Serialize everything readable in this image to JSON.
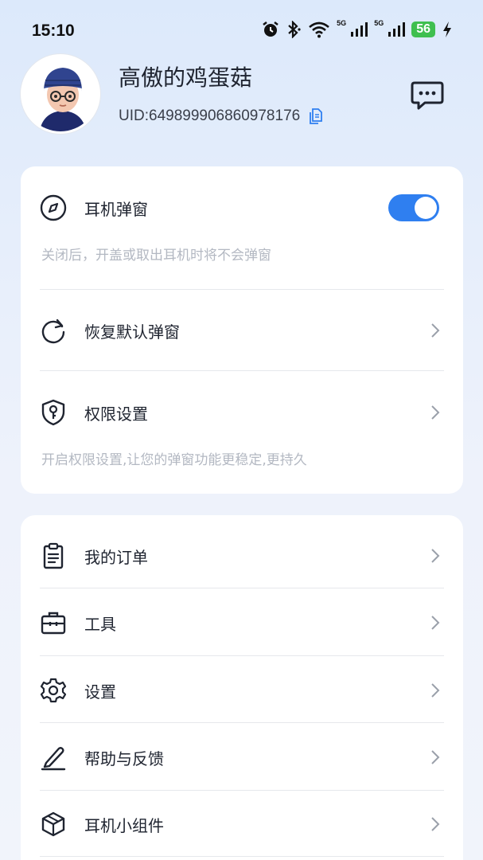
{
  "status_bar": {
    "time": "15:10",
    "net1": "5G",
    "net2": "5G",
    "battery": "56",
    "icons": [
      "alarm-icon",
      "bluetooth-icon",
      "wifi-icon",
      "signal-icon",
      "signal-icon",
      "battery-icon",
      "charging-icon"
    ]
  },
  "profile": {
    "username": "高傲的鸡蛋菇",
    "uid": "UID:649899906860978176",
    "icons": [
      "avatar",
      "copy-icon",
      "message-icon"
    ]
  },
  "popup_card": {
    "popup_toggle": {
      "label": "耳机弹窗",
      "hint": "关闭后，开盖或取出耳机时将不会弹窗",
      "enabled": true,
      "icon": "compass-icon"
    },
    "restore_default": {
      "label": "恢复默认弹窗",
      "icon": "refresh-icon"
    },
    "permissions": {
      "label": "权限设置",
      "hint": "开启权限设置,让您的弹窗功能更稳定,更持久",
      "icon": "shield-key-icon"
    }
  },
  "menu": {
    "items": [
      {
        "label": "我的订单",
        "icon": "clipboard-icon"
      },
      {
        "label": "工具",
        "icon": "toolbox-icon"
      },
      {
        "label": "设置",
        "icon": "gear-icon"
      },
      {
        "label": "帮助与反馈",
        "icon": "pencil-icon"
      },
      {
        "label": "耳机小组件",
        "icon": "cube-icon"
      }
    ]
  },
  "colors": {
    "accent": "#2f7ff0",
    "battery": "#3fbf4f",
    "copy_icon": "#2f7ff0",
    "hint_text": "#b3b8c2"
  }
}
